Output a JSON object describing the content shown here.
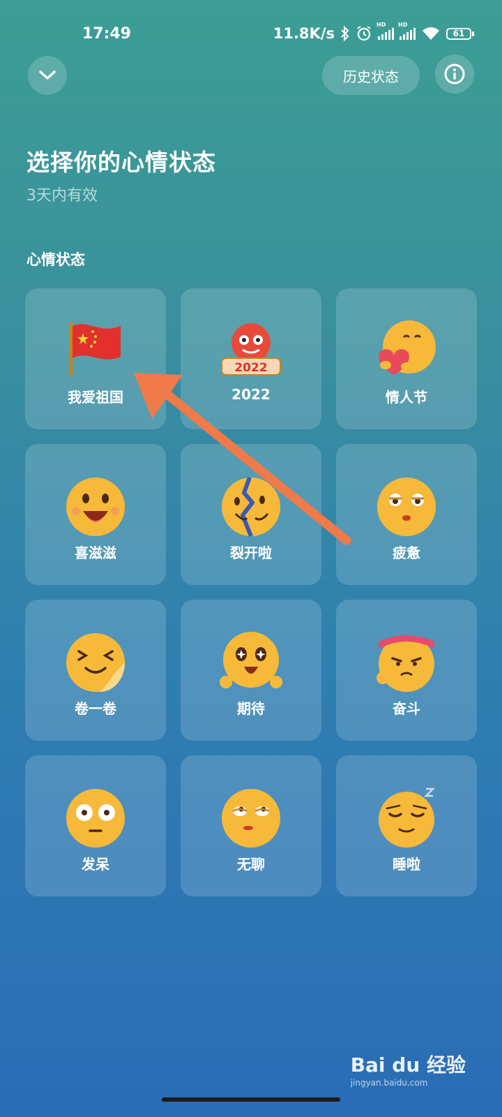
{
  "status_bar": {
    "time": "17:49",
    "net_speed": "11.8K/s",
    "icons": [
      "bluetooth-icon",
      "alarm-icon",
      "hd-signal-icon",
      "hd-signal-icon",
      "wifi-icon"
    ],
    "hd1": "HD",
    "hd2": "HD",
    "battery": "61"
  },
  "header": {
    "collapse_icon": "chevron-down-icon",
    "history_label": "历史状态",
    "info_icon": "info-icon"
  },
  "page": {
    "title": "选择你的心情状态",
    "subtitle": "3天内有效",
    "section_label": "心情状态"
  },
  "moods": [
    {
      "label": "我爱祖国",
      "icon": "china-flag-icon"
    },
    {
      "label": "2022",
      "icon": "lion-dance-2022-icon"
    },
    {
      "label": "情人节",
      "icon": "heart-hug-emoji-icon"
    },
    {
      "label": "喜滋滋",
      "icon": "happy-emoji-icon"
    },
    {
      "label": "裂开啦",
      "icon": "cracked-emoji-icon"
    },
    {
      "label": "疲惫",
      "icon": "tired-emoji-icon"
    },
    {
      "label": "卷一卷",
      "icon": "curled-emoji-icon"
    },
    {
      "label": "期待",
      "icon": "starry-eyes-emoji-icon"
    },
    {
      "label": "奋斗",
      "icon": "headband-emoji-icon"
    },
    {
      "label": "发呆",
      "icon": "dazed-emoji-icon"
    },
    {
      "label": "无聊",
      "icon": "bored-emoji-icon"
    },
    {
      "label": "睡啦",
      "icon": "sleeping-emoji-icon"
    }
  ],
  "watermark": {
    "brand": "Bai du 经验",
    "url": "jingyan.baidu.com"
  },
  "colors": {
    "arrow": "#f07a4a",
    "emoji": "#f7b93a"
  }
}
